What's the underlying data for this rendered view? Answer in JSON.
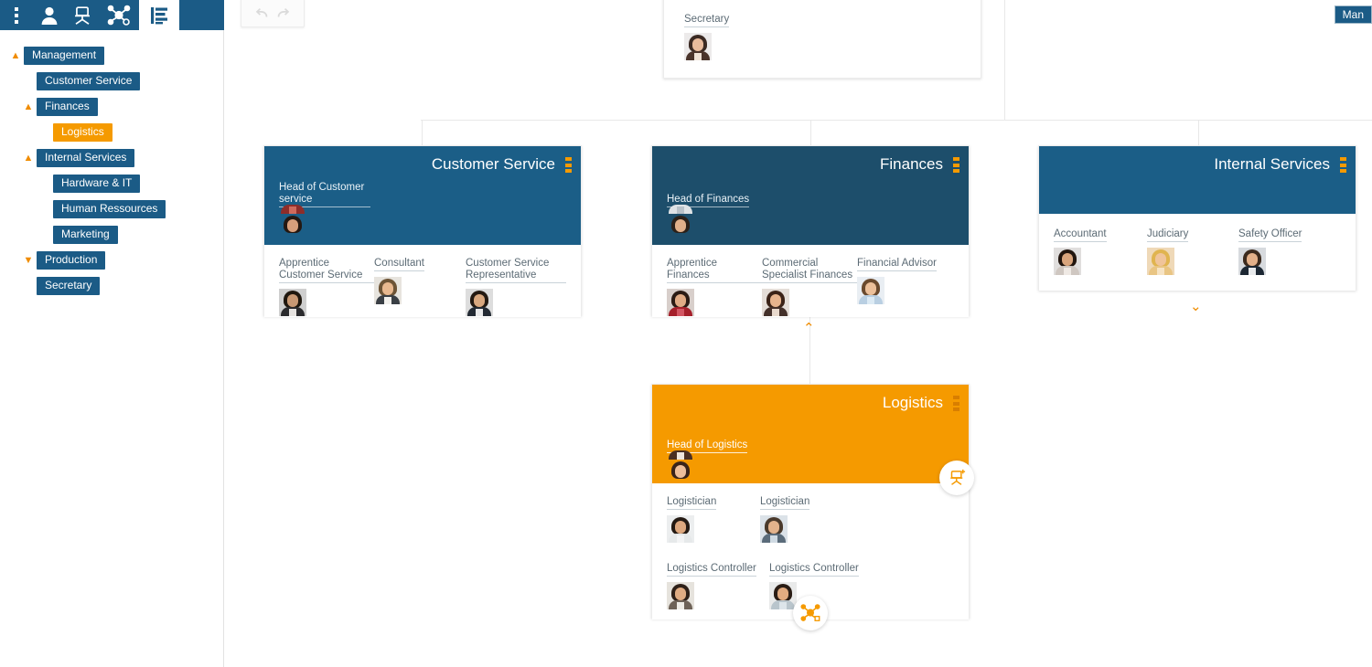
{
  "toolbar": {
    "buttons": [
      {
        "name": "more-options-icon",
        "label": "More options"
      },
      {
        "name": "person-icon",
        "label": "Person"
      },
      {
        "name": "office-chair-icon",
        "label": "Position"
      },
      {
        "name": "org-network-icon",
        "label": "Organisation"
      },
      {
        "name": "list-view-icon",
        "label": "List view",
        "active": true
      }
    ]
  },
  "history": {
    "undo_label": "Undo",
    "redo_label": "Redo"
  },
  "sidebar": {
    "items": [
      {
        "label": "Management",
        "indent": 0,
        "chevron": "up",
        "selected": false
      },
      {
        "label": "Customer Service",
        "indent": 1,
        "chevron": "none",
        "selected": false
      },
      {
        "label": "Finances",
        "indent": 1,
        "chevron": "up",
        "selected": false
      },
      {
        "label": "Logistics",
        "indent": 2,
        "chevron": "none",
        "selected": true
      },
      {
        "label": "Internal Services",
        "indent": 1,
        "chevron": "up",
        "selected": false
      },
      {
        "label": "Hardware & IT",
        "indent": 2,
        "chevron": "none",
        "selected": false
      },
      {
        "label": "Human Ressources",
        "indent": 2,
        "chevron": "none",
        "selected": false
      },
      {
        "label": "Marketing",
        "indent": 2,
        "chevron": "none",
        "selected": false
      },
      {
        "label": "Production",
        "indent": 1,
        "chevron": "down",
        "selected": false
      },
      {
        "label": "Secretary",
        "indent": 1,
        "chevron": "none",
        "selected": false
      }
    ]
  },
  "canvas": {
    "edge_node_label": "Man",
    "secretary_card": {
      "role": "Secretary"
    },
    "customer_service": {
      "title": "Customer Service",
      "head_role": "Head of Customer service",
      "employees": [
        {
          "role": "Apprentice Customer Service"
        },
        {
          "role": "Consultant"
        },
        {
          "role": "Customer Service Representative"
        }
      ]
    },
    "finances": {
      "title": "Finances",
      "head_role": "Head of Finances",
      "employees": [
        {
          "role": "Apprentice Finances"
        },
        {
          "role": "Commercial Specialist Finances"
        },
        {
          "role": "Financial Advisor"
        }
      ]
    },
    "internal_services": {
      "title": "Internal Services",
      "employees": [
        {
          "role": "Accountant"
        },
        {
          "role": "Judiciary"
        },
        {
          "role": "Safety Officer"
        }
      ]
    },
    "logistics": {
      "title": "Logistics",
      "head_role": "Head of Logistics",
      "employees": [
        {
          "role": "Logistician"
        },
        {
          "role": "Logistician"
        },
        {
          "role": "Logistics Controller"
        },
        {
          "role": "Logistics Controller"
        }
      ]
    },
    "toggles": {
      "finances_collapse": "⌃",
      "internal_services_expand": "⌄"
    }
  },
  "colors": {
    "brand_blue": "#1b5b86",
    "selected_blue": "#1d4e6b",
    "accent_orange": "#f59a00",
    "chevron_orange": "#f08c00",
    "connector_gray": "#e8e8e8"
  }
}
